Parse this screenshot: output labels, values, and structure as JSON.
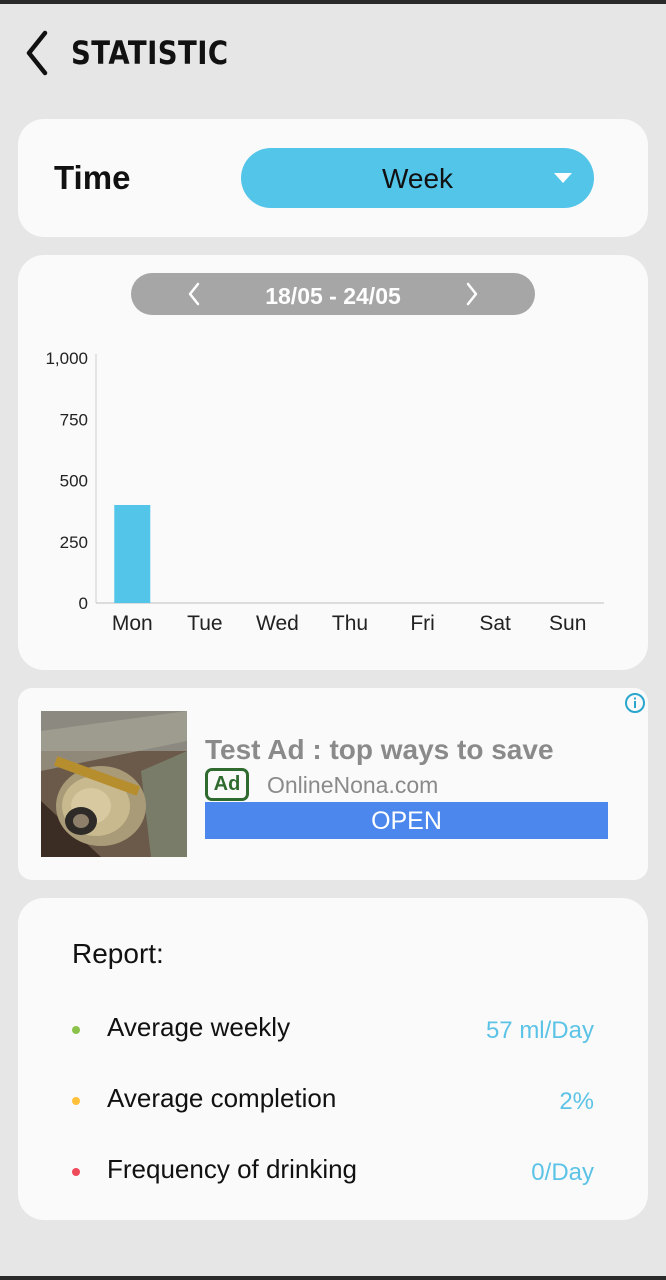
{
  "header": {
    "title": "STATISTIC",
    "back_icon": "chevron-left-icon"
  },
  "time_filter": {
    "label": "Time",
    "selected": "Week",
    "dropdown_icon": "caret-down-icon"
  },
  "date_range": {
    "label": "18/05 - 24/05",
    "prev_icon": "chevron-left-icon",
    "next_icon": "chevron-right-icon"
  },
  "chart_data": {
    "type": "bar",
    "categories": [
      "Mon",
      "Tue",
      "Wed",
      "Thu",
      "Fri",
      "Sat",
      "Sun"
    ],
    "values": [
      400,
      0,
      0,
      0,
      0,
      0,
      0
    ],
    "ylim": [
      0,
      1000
    ],
    "yticks": [
      "0",
      "250",
      "500",
      "750",
      "1,000"
    ],
    "title": "",
    "xlabel": "",
    "ylabel": "",
    "grid": false,
    "bar_color": "#53c5e9"
  },
  "ad": {
    "title": "Test Ad : top ways to save",
    "badge": "Ad",
    "domain": "OnlineNona.com",
    "cta": "OPEN",
    "info_icon": "info-icon",
    "image_icon": "money-roll-photo"
  },
  "report": {
    "title": "Report:",
    "rows": [
      {
        "label": "Average weekly",
        "value": "57 ml/Day",
        "dot_color": "#8bc34a"
      },
      {
        "label": "Average completion",
        "value": "2%",
        "dot_color": "#ffc03a"
      },
      {
        "label": "Frequency of drinking",
        "value": "0/Day",
        "dot_color": "#ee4a5a"
      }
    ]
  },
  "colors": {
    "accent": "#53c5e9",
    "background": "#e6e6e6",
    "card": "#fafafa",
    "ad_button": "#4c87ee"
  }
}
